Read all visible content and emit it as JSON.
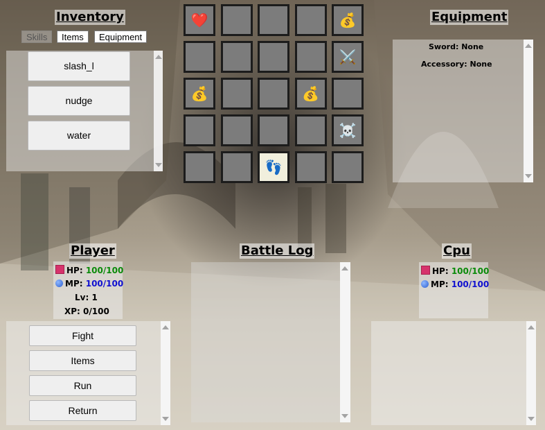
{
  "inventory": {
    "title": "Inventory",
    "tabs": [
      "Skills",
      "Items",
      "Equipment"
    ],
    "skills": [
      "slash_l",
      "nudge",
      "water"
    ]
  },
  "grid": {
    "rows": [
      [
        "heart-icon",
        "",
        "",
        "",
        "money-bag-icon"
      ],
      [
        "",
        "",
        "",
        "",
        "crossed-swords-icon"
      ],
      [
        "money-bag-icon",
        "",
        "",
        "money-bag-icon",
        ""
      ],
      [
        "",
        "",
        "",
        "",
        "skull-crossbones-icon"
      ],
      [
        "",
        "",
        "footprints-icon",
        "",
        ""
      ]
    ],
    "selected": [
      4,
      2
    ]
  },
  "equipment": {
    "title": "Equipment",
    "sword_label": "Sword:",
    "sword_value": "None",
    "accessory_label": "Accessory:",
    "accessory_value": "None"
  },
  "player": {
    "title": "Player",
    "hp_label": "HP:",
    "hp_value": "100/100",
    "mp_label": "MP:",
    "mp_value": "100/100",
    "lv_label": "Lv:",
    "lv_value": "1",
    "xp_label": "XP:",
    "xp_value": "0/100",
    "actions": [
      "Fight",
      "Items",
      "Run",
      "Return"
    ]
  },
  "battle_log": {
    "title": "Battle Log"
  },
  "cpu": {
    "title": "Cpu",
    "hp_label": "HP:",
    "hp_value": "100/100",
    "mp_label": "MP:",
    "mp_value": "100/100"
  },
  "colors": {
    "hp": "#0a8a0a",
    "mp": "#1010d0",
    "cell": "#7c7c7c",
    "cell_selected": "#f1efdd"
  }
}
